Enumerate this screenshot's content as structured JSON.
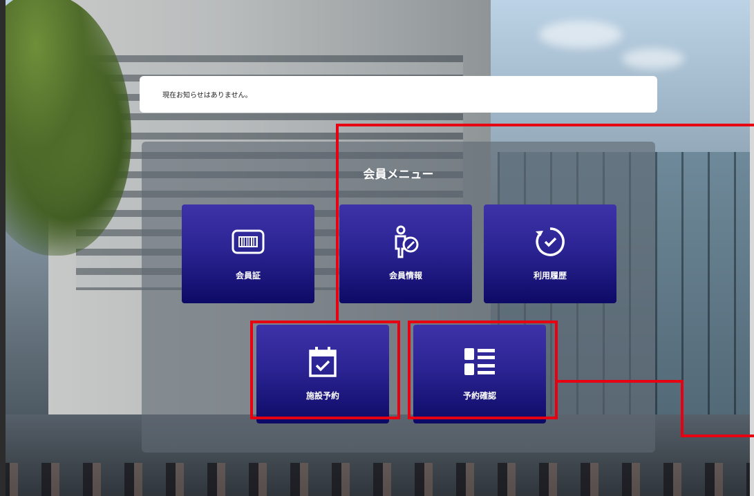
{
  "notice": {
    "text": "現在お知らせはありません。"
  },
  "menu": {
    "title": "会員メニュー",
    "items": [
      {
        "label": "会員証",
        "icon": "barcode-card-icon"
      },
      {
        "label": "会員情報",
        "icon": "member-edit-icon"
      },
      {
        "label": "利用履歴",
        "icon": "history-clock-icon"
      },
      {
        "label": "施設予約",
        "icon": "calendar-check-icon"
      },
      {
        "label": "予約確認",
        "icon": "list-icon"
      }
    ]
  },
  "colors": {
    "tile_top": "#3e32a8",
    "tile_bottom": "#0d0a66",
    "highlight": "#e60012"
  }
}
